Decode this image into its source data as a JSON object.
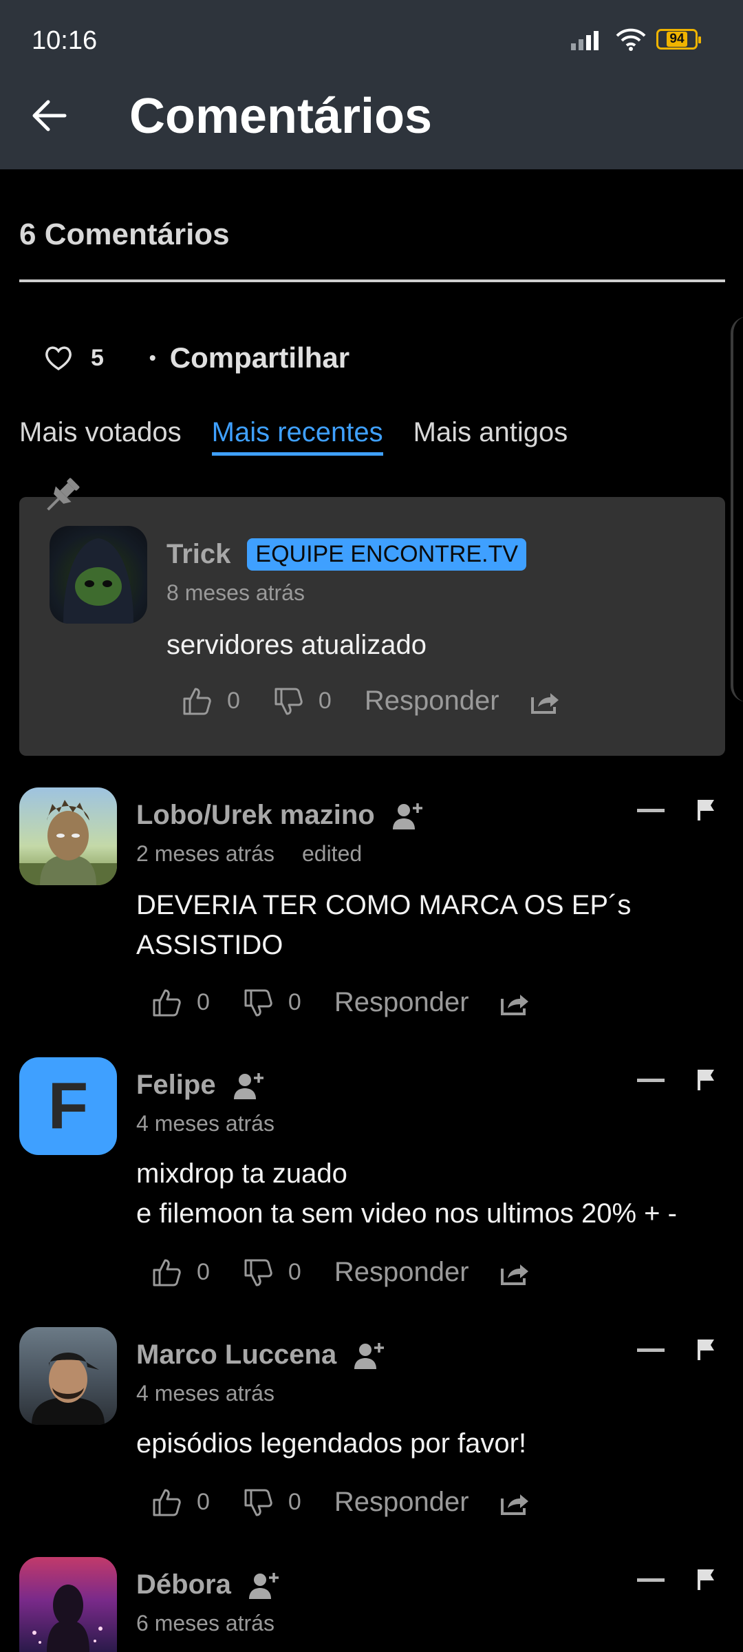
{
  "status_bar": {
    "time": "10:16",
    "battery": "94"
  },
  "header": {
    "title": "Comentários"
  },
  "comments_count": "6 Comentários",
  "actions": {
    "likes": "5",
    "share_label": "Compartilhar"
  },
  "sort_tabs": [
    "Mais votados",
    "Mais recentes",
    "Mais antigos"
  ],
  "active_sort": "Mais recentes",
  "pinned_comment": {
    "author": "Trick",
    "badge": "EQUIPE ENCONTRE.TV",
    "time": "8 meses atrás",
    "text": "servidores atualizado",
    "likes": "0",
    "dislikes": "0",
    "reply_label": "Responder"
  },
  "comments": [
    {
      "author": "Lobo/Urek mazino",
      "time": "2 meses atrás",
      "edited": "edited",
      "text": "DEVERIA TER COMO MARCA OS EP´s\nASSISTIDO",
      "likes": "0",
      "dislikes": "0",
      "reply_label": "Responder"
    },
    {
      "author": "Felipe",
      "avatar_letter": "F",
      "time": "4 meses atrás",
      "text": "mixdrop ta zuado\ne filemoon ta sem video nos ultimos 20% + -",
      "likes": "0",
      "dislikes": "0",
      "reply_label": "Responder"
    },
    {
      "author": "Marco Luccena",
      "time": "4 meses atrás",
      "text": "episódios legendados por favor!",
      "likes": "0",
      "dislikes": "0",
      "reply_label": "Responder"
    },
    {
      "author": "Débora",
      "time": "6 meses atrás"
    }
  ],
  "colors": {
    "accent": "#3fa0ff",
    "header_bg": "#2e343c",
    "card_bg": "#333333"
  }
}
